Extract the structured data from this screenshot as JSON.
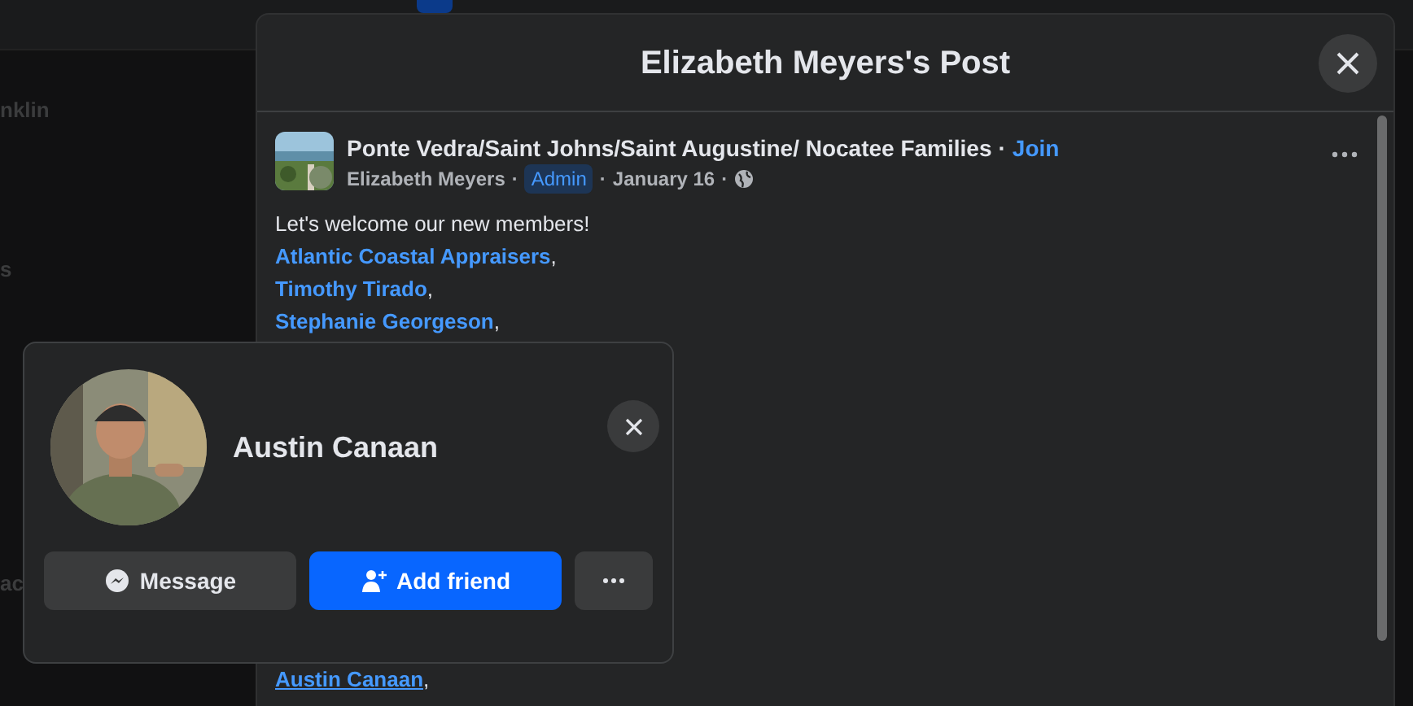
{
  "background": {
    "sidebar_fragments": [
      "nklin",
      "s",
      "ac"
    ]
  },
  "modal": {
    "title": "Elizabeth Meyers's Post",
    "post": {
      "group": "Ponte Vedra/Saint Johns/Saint Augustine/ Nocatee Families",
      "separator": "·",
      "join": "Join",
      "author": "Elizabeth Meyers",
      "badge": "Admin",
      "date": "January 16",
      "text": "Let's welcome our new members!",
      "mentions": [
        {
          "name": "Atlantic Coastal Appraisers",
          "suffix": ",",
          "hovered": false
        },
        {
          "name": "Timothy Tirado",
          "suffix": ",",
          "hovered": false
        },
        {
          "name": "Stephanie Georgeson",
          "suffix": ",",
          "hovered": false
        }
      ],
      "later_mentions": [
        {
          "name": "Austin Canaan",
          "suffix": ",",
          "hovered": true
        }
      ]
    }
  },
  "profile_card": {
    "name": "Austin Canaan",
    "buttons": [
      {
        "kind": "message",
        "label": "Message"
      },
      {
        "kind": "add_friend",
        "label": "Add friend"
      },
      {
        "kind": "more"
      }
    ]
  }
}
